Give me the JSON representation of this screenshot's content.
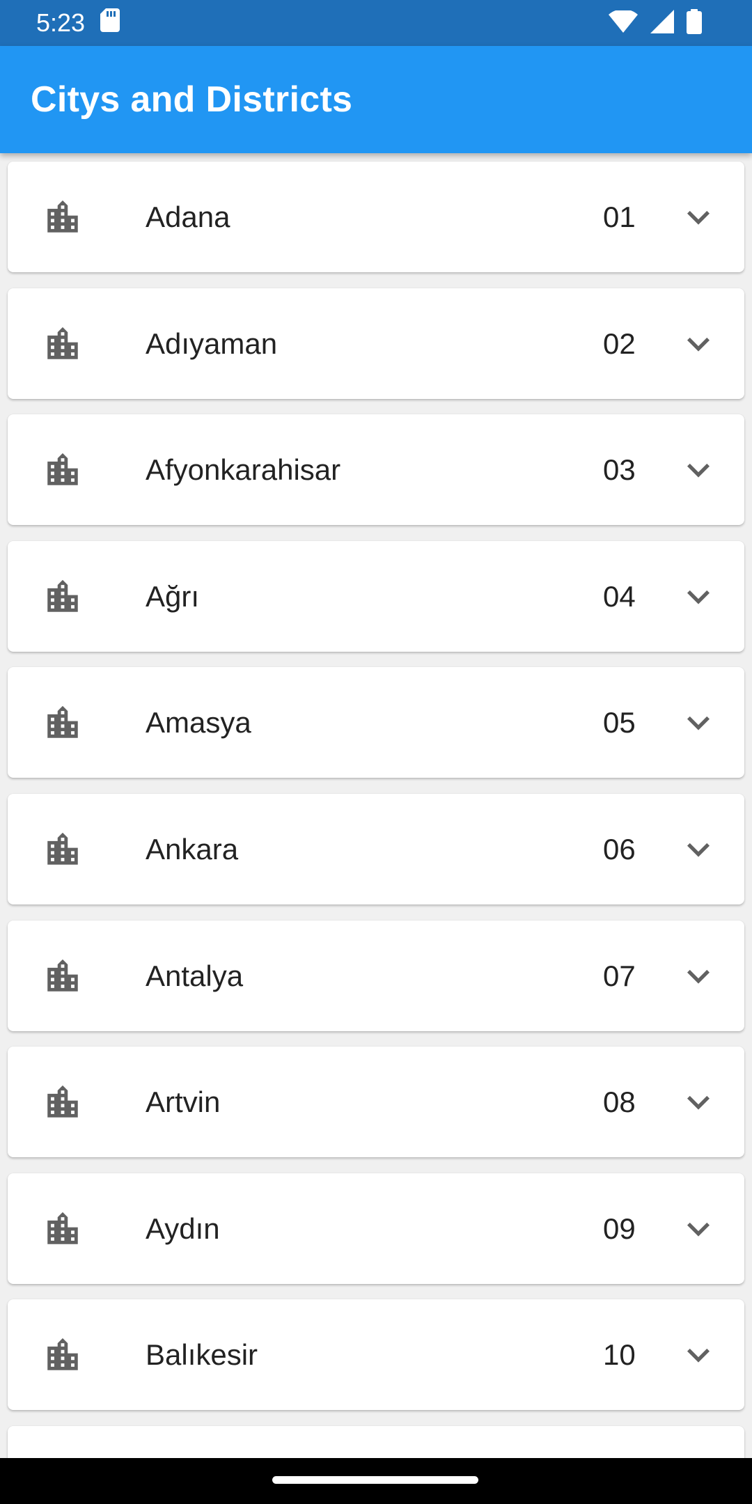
{
  "status_bar": {
    "time": "5:23",
    "icons": [
      "sd-card-icon",
      "wifi-icon",
      "signal-icon",
      "battery-icon"
    ]
  },
  "app_bar": {
    "title": "Citys and Districts",
    "color": "#2196f3"
  },
  "cities": [
    {
      "name": "Adana",
      "code": "01"
    },
    {
      "name": "Adıyaman",
      "code": "02"
    },
    {
      "name": "Afyonkarahisar",
      "code": "03"
    },
    {
      "name": "Ağrı",
      "code": "04"
    },
    {
      "name": "Amasya",
      "code": "05"
    },
    {
      "name": "Ankara",
      "code": "06"
    },
    {
      "name": "Antalya",
      "code": "07"
    },
    {
      "name": "Artvin",
      "code": "08"
    },
    {
      "name": "Aydın",
      "code": "09"
    },
    {
      "name": "Balıkesir",
      "code": "10"
    }
  ],
  "list_icons": {
    "leading": "city-icon",
    "trailing": "chevron-down-icon"
  },
  "colors": {
    "status_bar": "#1f6fb8",
    "icon": "#616161",
    "text": "#222222"
  }
}
